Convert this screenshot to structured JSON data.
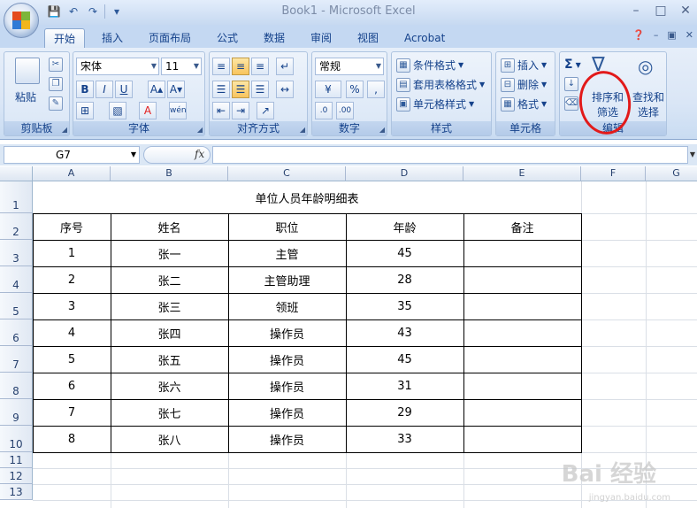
{
  "window": {
    "title": "Book1 - Microsoft Excel"
  },
  "tabs": [
    "开始",
    "插入",
    "页面布局",
    "公式",
    "数据",
    "审阅",
    "视图",
    "Acrobat"
  ],
  "ribbon": {
    "clipboard": {
      "label": "剪贴板",
      "paste": "粘贴"
    },
    "font": {
      "label": "字体",
      "name": "宋体",
      "size": "11",
      "bold": "B",
      "italic": "I",
      "underline": "U"
    },
    "alignment": {
      "label": "对齐方式"
    },
    "number": {
      "label": "数字",
      "format": "常规",
      "percent": "%",
      "comma": ","
    },
    "styles": {
      "label": "样式",
      "conditional": "条件格式",
      "table_format": "套用表格格式",
      "cell_styles": "单元格样式"
    },
    "cells": {
      "label": "单元格",
      "insert": "插入",
      "delete": "删除",
      "format": "格式"
    },
    "editing": {
      "label": "编辑",
      "sort_filter_1": "排序和",
      "sort_filter_2": "筛选",
      "find_select_1": "查找和",
      "find_select_2": "选择"
    }
  },
  "formula_bar": {
    "name_box": "G7",
    "fx": "fx",
    "value": ""
  },
  "columns": [
    "A",
    "B",
    "C",
    "D",
    "E",
    "F",
    "G"
  ],
  "rows": [
    "1",
    "2",
    "3",
    "4",
    "5",
    "6",
    "7",
    "8",
    "9",
    "10",
    "11",
    "12",
    "13"
  ],
  "sheet": {
    "title": "单位人员年龄明细表",
    "headers": [
      "序号",
      "姓名",
      "职位",
      "年龄",
      "备注"
    ],
    "records": [
      [
        "1",
        "张一",
        "主管",
        "45",
        ""
      ],
      [
        "2",
        "张二",
        "主管助理",
        "28",
        ""
      ],
      [
        "3",
        "张三",
        "领班",
        "35",
        ""
      ],
      [
        "4",
        "张四",
        "操作员",
        "43",
        ""
      ],
      [
        "5",
        "张五",
        "操作员",
        "45",
        ""
      ],
      [
        "6",
        "张六",
        "操作员",
        "31",
        ""
      ],
      [
        "7",
        "张七",
        "操作员",
        "29",
        ""
      ],
      [
        "8",
        "张八",
        "操作员",
        "33",
        ""
      ]
    ]
  },
  "watermark": {
    "main": "Bai 经验",
    "sub": "jingyan.baidu.com"
  },
  "colors": {
    "accent": "#15428b",
    "annotation": "#e21a1a"
  }
}
